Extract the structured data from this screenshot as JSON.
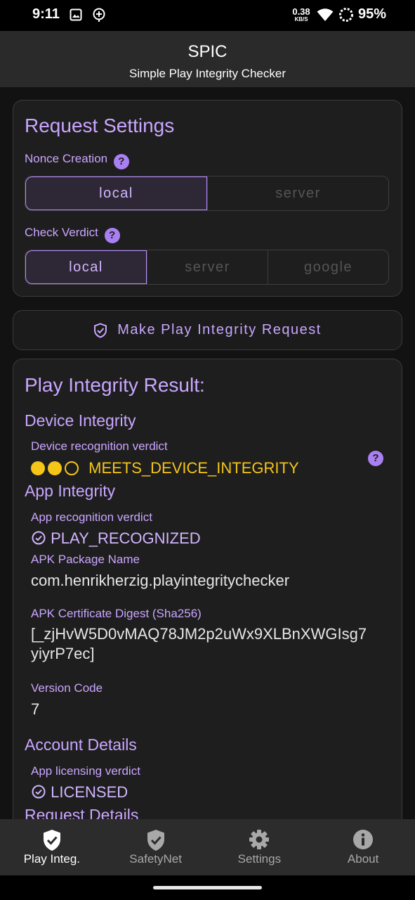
{
  "status_bar": {
    "time": "9:11",
    "speed_value": "0.38",
    "speed_unit": "KB/S",
    "battery": "95%",
    "icons": [
      "gallery-icon",
      "assistant-icon",
      "wifi-icon",
      "battery-ring-icon"
    ]
  },
  "app_bar": {
    "title": "SPIC",
    "subtitle": "Simple Play Integrity Checker"
  },
  "request_settings": {
    "title": "Request Settings",
    "nonce_label": "Nonce Creation",
    "nonce_options": [
      "local",
      "server"
    ],
    "nonce_selected": "local",
    "verdict_label": "Check Verdict",
    "verdict_options": [
      "local",
      "server",
      "google"
    ],
    "verdict_selected": "local",
    "help_glyph": "?"
  },
  "request_button": {
    "label": "Make Play Integrity Request",
    "icon": "shield-check-icon"
  },
  "result": {
    "title": "Play Integrity Result:",
    "device_integrity": {
      "heading": "Device Integrity",
      "label": "Device recognition verdict",
      "value": "MEETS_DEVICE_INTEGRITY",
      "levels_met": 2,
      "levels_total": 3,
      "status_color": "#f5c518"
    },
    "app_integrity": {
      "heading": "App Integrity",
      "recognition_label": "App recognition verdict",
      "recognition_value": "PLAY_RECOGNIZED",
      "package_label": "APK Package Name",
      "package_value": "com.henrikherzig.playintegritychecker",
      "digest_label": "APK Certificate Digest (Sha256)",
      "digest_line1": "[_zjHvW5D0vMAQ78JM2p2uWx9XLBnXWGIsg7",
      "digest_line2": "yiyrP7ec]",
      "version_label": "Version Code",
      "version_value": "7"
    },
    "account_details": {
      "heading": "Account Details",
      "licensing_label": "App licensing verdict",
      "licensing_value": "LICENSED"
    },
    "request_details": {
      "heading": "Request Details"
    }
  },
  "bottom_nav": {
    "items": [
      {
        "label": "Play Integ.",
        "icon": "shield-check-icon",
        "active": true
      },
      {
        "label": "SafetyNet",
        "icon": "shield-check-icon",
        "active": false
      },
      {
        "label": "Settings",
        "icon": "gear-icon",
        "active": false
      },
      {
        "label": "About",
        "icon": "info-icon",
        "active": false
      }
    ]
  },
  "colors": {
    "accent": "#c9a6ff",
    "warning": "#f5c518",
    "background": "#121212",
    "card": "#1e1e1e"
  }
}
